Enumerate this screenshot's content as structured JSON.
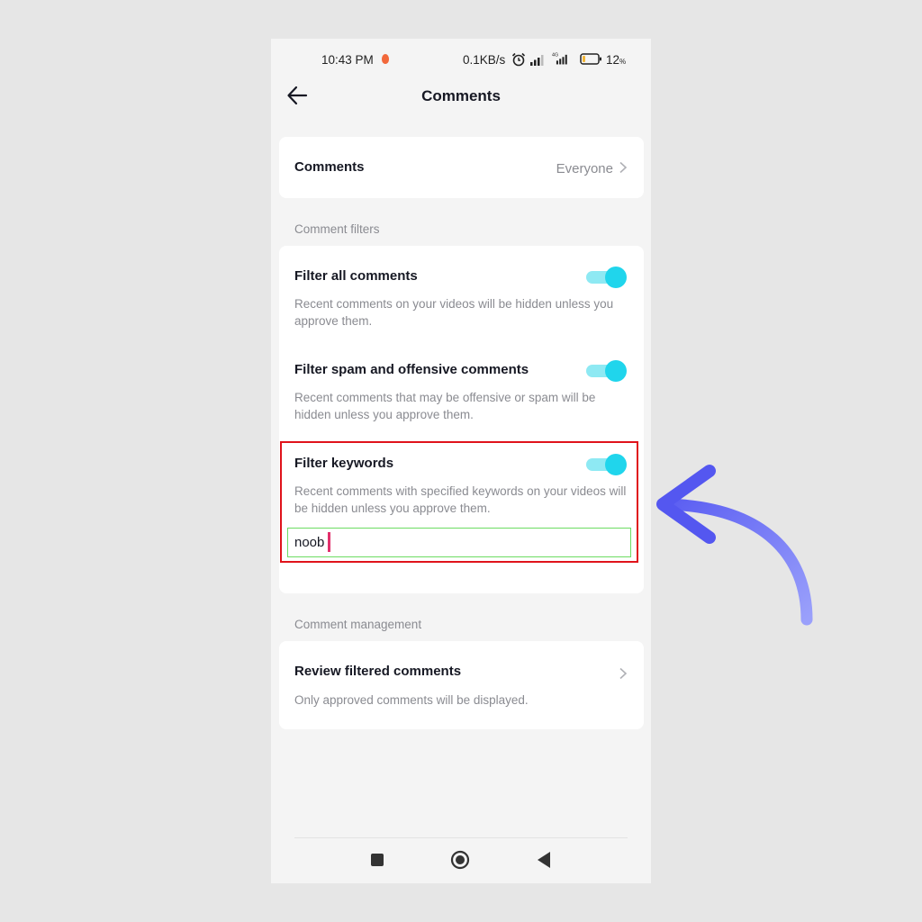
{
  "status_bar": {
    "time": "10:43 PM",
    "net_speed": "0.1KB/s",
    "network_type": "4G",
    "battery_percent": "12",
    "battery_unit": "%",
    "icons": [
      "flame-notification-icon",
      "alarm-icon",
      "signal-icon",
      "signal-4g-icon",
      "battery-icon"
    ]
  },
  "header": {
    "title": "Comments",
    "back_icon": "arrow-left-icon"
  },
  "comments_setting": {
    "label": "Comments",
    "value": "Everyone"
  },
  "comment_filters": {
    "section_label": "Comment filters",
    "items": [
      {
        "title": "Filter all comments",
        "description": "Recent comments on your videos will be hidden unless you approve them.",
        "enabled": true
      },
      {
        "title": "Filter spam and offensive comments",
        "description": "Recent comments that may be offensive or spam will be hidden unless you approve them.",
        "enabled": true
      },
      {
        "title": "Filter keywords",
        "description": "Recent comments with specified keywords on your videos will be hidden unless you approve them.",
        "enabled": true
      }
    ],
    "keyword_input_value": "noob"
  },
  "comment_management": {
    "section_label": "Comment management",
    "review_title": "Review filtered comments",
    "review_description": "Only approved comments will be displayed."
  },
  "nav_bar": {
    "icons": [
      "recents-square-icon",
      "home-circle-icon",
      "back-triangle-icon"
    ]
  },
  "colors": {
    "toggle_knob": "#20d5ec",
    "toggle_track": "#8ee9f3",
    "highlight_box": "#e0131b",
    "input_border": "#6cdc62",
    "caret": "#e2306c",
    "annotation_arrow": "#6b6ef5"
  }
}
